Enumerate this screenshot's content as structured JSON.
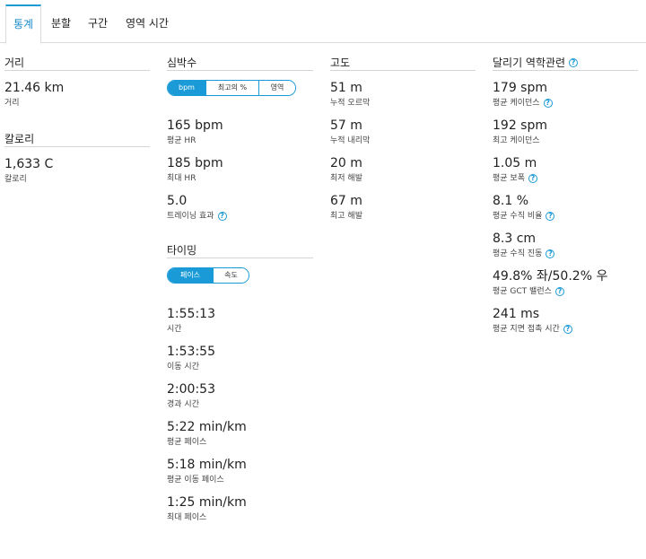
{
  "tabs": [
    "통계",
    "분할",
    "구간",
    "영역 시간"
  ],
  "distance": {
    "title": "거리",
    "value": "21.46 km",
    "label": "거리"
  },
  "calories": {
    "title": "칼로리",
    "value": "1,633 C",
    "label": "칼로리"
  },
  "heart_rate": {
    "title": "심박수",
    "toggle": [
      "bpm",
      "최고의 %",
      "영역"
    ],
    "selected_toggle": "bpm",
    "stats": [
      {
        "value": "165 bpm",
        "label": "평균 HR"
      },
      {
        "value": "185 bpm",
        "label": "최대 HR"
      },
      {
        "value": "5.0",
        "label": "트레이닝 효과"
      }
    ]
  },
  "timing": {
    "title": "타이밍",
    "toggle": [
      "페이스",
      "속도"
    ],
    "selected_toggle": "페이스",
    "stats": [
      {
        "value": "1:55:13",
        "label": "시간"
      },
      {
        "value": "1:53:55",
        "label": "이동 시간"
      },
      {
        "value": "2:00:53",
        "label": "경과 시간"
      },
      {
        "value": "5:22 min/km",
        "label": "평균 페이스"
      },
      {
        "value": "5:18 min/km",
        "label": "평균 이동 페이스"
      },
      {
        "value": "1:25 min/km",
        "label": "최대 페이스"
      }
    ]
  },
  "elevation": {
    "title": "고도",
    "stats": [
      {
        "value": "51 m",
        "label": "누적 오르막"
      },
      {
        "value": "57 m",
        "label": "누적 내리막"
      },
      {
        "value": "20 m",
        "label": "최저 해발"
      },
      {
        "value": "67 m",
        "label": "최고 해발"
      }
    ]
  },
  "dynamics": {
    "title": "달리기 역학관련",
    "stats": [
      {
        "value": "179 spm",
        "label": "평균 케이던스"
      },
      {
        "value": "192 spm",
        "label": "최고 케이던스"
      },
      {
        "value": "1.05 m",
        "label": "평균 보폭"
      },
      {
        "value": "8.1 %",
        "label": "평균 수직 비율"
      },
      {
        "value": "8.3 cm",
        "label": "평균 수직 진동"
      },
      {
        "value": "49.8% 좌/50.2% 우",
        "label": "평균 GCT 밸런스"
      },
      {
        "value": "241 ms",
        "label": "평균 지면 접촉 시간"
      }
    ]
  },
  "help_glyph": "?",
  "colors": {
    "accent": "#1a9ad6",
    "border": "#dcdcdc"
  }
}
